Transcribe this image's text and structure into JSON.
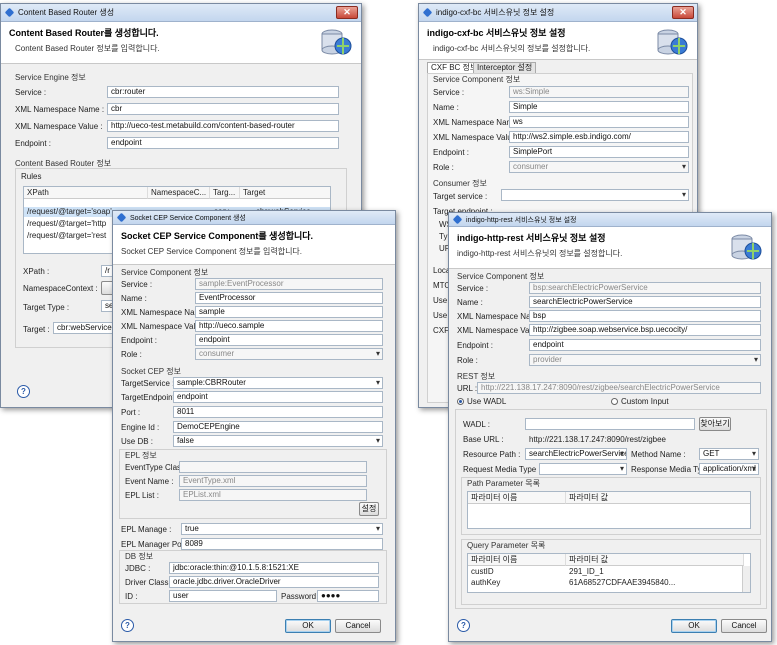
{
  "router": {
    "title": "Content Based Router 생성",
    "header_title": "Content Based Router를 생성합니다.",
    "header_sub": "Content Based Router 정보를 입력합니다.",
    "section_engine": "Service Engine 정보",
    "service_label": "Service :",
    "service_value": "cbr:router",
    "ns_label": "XML Namespace Name :",
    "ns_value": "cbr",
    "nsv_label": "XML Namespace Value :",
    "nsv_value": "http://ueco-test.metabuild.com/content-based-router",
    "endpoint_label": "Endpoint :",
    "endpoint_value": "endpoint",
    "section_cbr": "Content Based Router 정보",
    "rules_label": "Rules",
    "rules_cols": [
      "XPath",
      "NamespaceC...",
      "Targ...",
      "Target"
    ],
    "rules_rows": [
      [
        "/request/@target='soap'",
        "",
        "serv...",
        "cbr:webService"
      ],
      [
        "/request/@target='http",
        "",
        "",
        ""
      ],
      [
        "/request/@target='rest",
        "",
        "",
        ""
      ]
    ],
    "xpath_label": "XPath :",
    "xpath_value": "/r",
    "nsctx_label": "NamespaceContext :",
    "ttype_label": "Target Type :",
    "ttype_value": "se",
    "target_label": "Target :",
    "target_value": "cbr:webService"
  },
  "cxf": {
    "title": "indigo-cxf-bc 서비스유닛 정보 설정",
    "header_title": "indigo-cxf-bc 서비스유닛 정보 설정",
    "header_sub": "indigo-cxf-bc 서비스유닛의 정보를 설정합니다.",
    "tab1": "CXF BC 정보",
    "tab2": "Interceptor 설정",
    "section_comp": "Service Component 정보",
    "service_label": "Service :",
    "service_value": "ws:Simple",
    "name_label": "Name :",
    "name_value": "Simple",
    "ns_label": "XML Namespace Name :",
    "ns_value": "ws",
    "nsv_label": "XML Namespace Value :",
    "nsv_value": "http://ws2.simple.esb.indigo.com/",
    "endpoint_label": "Endpoint :",
    "endpoint_value": "SimplePort",
    "role_label": "Role :",
    "role_value": "consumer",
    "section_consumer": "Consumer 정보",
    "tservice_label": "Target service :",
    "tendpoint_label": "Target endpoint :",
    "trunc": [
      "WS",
      "Typ",
      "URI",
      "Loca",
      "MTO",
      "Use",
      "Use",
      "CXF"
    ]
  },
  "cep": {
    "title": "Socket CEP Service Component 생성",
    "header_title": "Socket CEP Service Component를 생성합니다.",
    "header_sub": "Socket CEP Service Component 정보를 입력합니다.",
    "section_comp": "Service Component 정보",
    "service_label": "Service :",
    "service_value": "sample:EventProcessor",
    "name_label": "Name :",
    "name_value": "EventProcessor",
    "ns_label": "XML Namespace Name :",
    "ns_value": "sample",
    "nsv_label": "XML Namespace Value :",
    "nsv_value": "http://ueco.sample",
    "endpoint_label": "Endpoint :",
    "endpoint_value": "endpoint",
    "role_label": "Role :",
    "role_value": "consumer",
    "section_socket": "Socket CEP 정보",
    "tservice_label": "TargetService :",
    "tservice_value": "sample:CBRRouter",
    "tendpoint_label": "TargetEndpoint :",
    "tendpoint_value": "endpoint",
    "port_label": "Port :",
    "port_value": "8011",
    "engine_label": "Engine Id :",
    "engine_value": "DemoCEPEngine",
    "usedb_label": "Use DB :",
    "usedb_value": "false",
    "section_epl": "EPL 정보",
    "etc_label": "EventType Class :",
    "ename_label": "Event Name :",
    "ename_value": "EventType.xml",
    "elist_label": "EPL List :",
    "elist_value": "EPList.xml",
    "set_button": "설정",
    "eplm_label": "EPL Manage :",
    "eplm_value": "true",
    "eplport_label": "EPL Manager Port :",
    "eplport_value": "8089",
    "section_db": "DB 정보",
    "jdbc_label": "JDBC :",
    "jdbc_value": "jdbc:oracle:thin:@10.1.5.8:1521:XE",
    "driver_label": "Driver Class :",
    "driver_value": "oracle.jdbc.driver.OracleDriver",
    "id_label": "ID :",
    "id_value": "user",
    "pw_label": "Password :",
    "pw_value": "●●●●",
    "ok": "OK",
    "cancel": "Cancel"
  },
  "rest": {
    "title": "indigo-http-rest 서비스유닛 정보 설정",
    "header_title": "indigo-http-rest 서비스유닛 정보 설정",
    "header_sub": "indigo-http-rest 서비스유닛의 정보를 설정합니다.",
    "section_comp": "Service Component 정보",
    "service_label": "Service :",
    "service_value": "bsp:searchElectricPowerService",
    "name_label": "Name :",
    "name_value": "searchElectricPowerService",
    "ns_label": "XML Namespace Name :",
    "ns_value": "bsp",
    "nsv_label": "XML Namespace Value :",
    "nsv_value": "http://zigbee.soap.webservice.bsp.uecocity/",
    "endpoint_label": "Endpoint :",
    "endpoint_value": "endpoint",
    "role_label": "Role :",
    "role_value": "provider",
    "section_rest": "REST 정보",
    "url_label": "URL :",
    "url_value": "http://221.138.17.247:8090/rest/zigbee/searchElectricPowerService",
    "use_wadl": "Use WADL",
    "custom_input": "Custom Input",
    "wadl_label": "WADL :",
    "browse": "찾아보기",
    "baseurl_label": "Base URL :",
    "baseurl_value": "http://221.138.17.247:8090/rest/zigbee",
    "rpath_label": "Resource Path :",
    "rpath_value": "searchElectricPowerService",
    "method_label": "Method Name :",
    "method_value": "GET",
    "reqmt_label": "Request Media Type :",
    "resmt_label": "Response Media Type :",
    "resmt_value": "application/xml",
    "path_params_label": "Path Parameter 목록",
    "param_cols": [
      "파라미터 이름",
      "파라미터 값"
    ],
    "query_params_label": "Query Parameter 목록",
    "query_rows": [
      [
        "custID",
        "291_ID_1"
      ],
      [
        "authKey",
        "61A68527CDFAAE3945840..."
      ]
    ],
    "ok": "OK",
    "cancel": "Cancel"
  },
  "colors": {
    "accent": "#2a5aa8",
    "title_bar": "#c3d6ee",
    "close": "#c8493a"
  }
}
